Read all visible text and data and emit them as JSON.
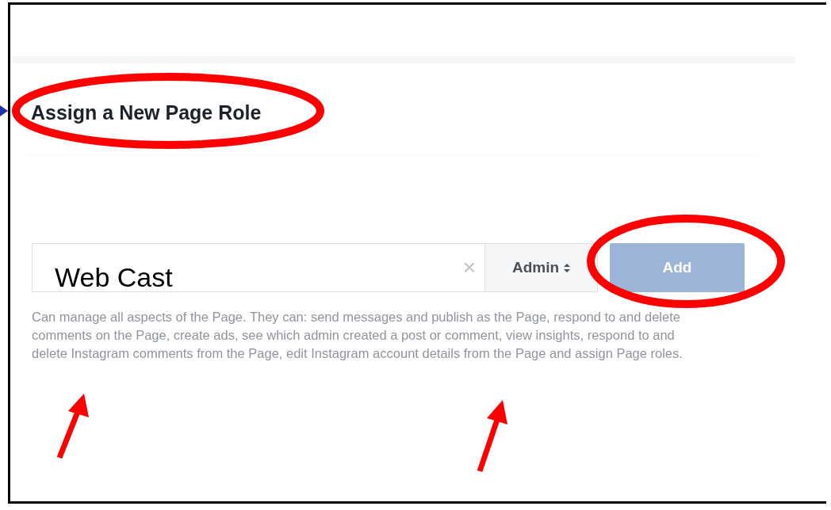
{
  "heading": "Assign a New Page Role",
  "name_field": {
    "value": "Web Cast",
    "clear": "×"
  },
  "role_dropdown": {
    "value": "Admin"
  },
  "add_button": {
    "label": "Add",
    "disabled": true
  },
  "description": "Can manage all aspects of the Page. They can: send messages and publish as the Page, respond to and delete comments on the Page, create ads, see which admin created a post or comment, view insights, respond to and delete Instagram comments from the Page, edit Instagram account details from the Page and assign Page roles."
}
